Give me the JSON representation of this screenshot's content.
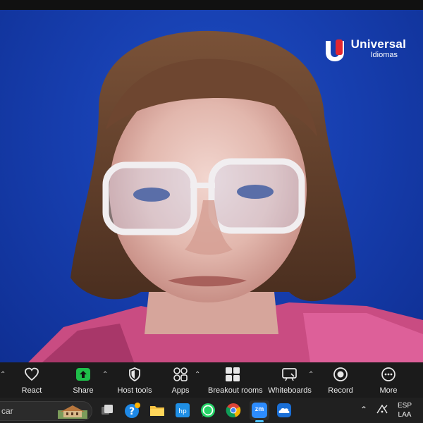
{
  "brand": {
    "name": "Universal",
    "subtitle": "Idiomas",
    "colors": {
      "mark_red": "#e3262f",
      "mark_white": "#ffffff",
      "background_blue": "#173fb0"
    }
  },
  "toolbar": {
    "items": [
      {
        "label": "React",
        "icon": "heart-icon"
      },
      {
        "label": "Share",
        "icon": "share-screen-icon",
        "color": "#1fbf4a"
      },
      {
        "label": "Host tools",
        "icon": "shield-icon"
      },
      {
        "label": "Apps",
        "icon": "apps-icon"
      },
      {
        "label": "Breakout rooms",
        "icon": "breakout-rooms-icon"
      },
      {
        "label": "Whiteboards",
        "icon": "whiteboard-icon"
      },
      {
        "label": "Record",
        "icon": "record-icon"
      },
      {
        "label": "More",
        "icon": "more-icon"
      }
    ]
  },
  "taskbar": {
    "search_text": "car",
    "apps": [
      "task-view-icon",
      "help-icon",
      "file-explorer-icon",
      "hp-icon",
      "whatsapp-icon",
      "chrome-icon",
      "zoom-icon",
      "onedrive-icon"
    ],
    "zoom_label": "zm",
    "language": {
      "line1": "ESP",
      "line2": "LAA"
    }
  }
}
